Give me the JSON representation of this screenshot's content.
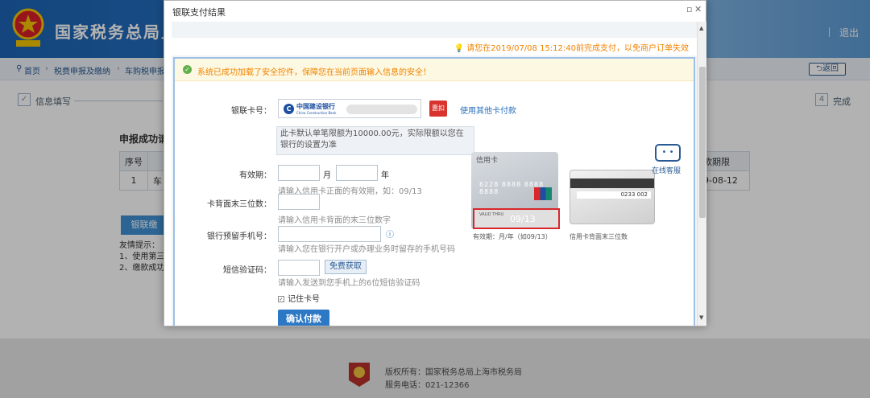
{
  "header": {
    "title": "国家税务总局上",
    "logout": "退出"
  },
  "breadcrumb": {
    "items": [
      "首页",
      "税费申报及缴纳",
      "车购税申报"
    ],
    "back": "返回"
  },
  "steps": {
    "first": "信息填写",
    "last_num": "4",
    "last": "完成"
  },
  "background": {
    "title": "申报成功请",
    "table_headers": [
      "序号",
      ""
    ],
    "table_row": [
      "1",
      "车"
    ],
    "right_header": "款期限",
    "right_value": "9-08-12",
    "button": "银联缴",
    "tips": [
      "友情提示：",
      "1、使用第三",
      "2、缴款成功"
    ]
  },
  "modal": {
    "title": "银联支付结果",
    "deadline_notice": "请您在2019/07/08 15:12:40前完成支付，以免商户订单失效",
    "security_notice": "系统已成功加载了安全控件，保障您在当前页面输入信息的安全！",
    "card_label": "银联卡号：",
    "bank_name": "中国建设银行",
    "bank_en": "China Construction Bank",
    "discount": "惠扣",
    "other_card": "使用其他卡付款",
    "limit_tip": "此卡默认单笔限额为10000.00元，实际限额以您在银行的设置为准",
    "expiry_label": "有效期：",
    "month": "月",
    "year": "年",
    "expiry_hint": "请输入信用卡正面的有效期，如：09/13",
    "cvv_label": "卡背面末三位数：",
    "cvv_hint": "请输入信用卡背面的末三位数字",
    "phone_label": "银行预留手机号：",
    "phone_hint": "请输入您在银行开户或办理业务时留存的手机号码",
    "sms_label": "短信验证码：",
    "sms_button": "免费获取",
    "sms_hint": "请输入发送到您手机上的6位短信验证码",
    "remember": "记住卡号",
    "confirm": "确认付款",
    "card_front_label": "信用卡",
    "card_number": "6228 8888 8888 8888",
    "valid_thru": "VALID THRU",
    "expiry_example": "09/13",
    "expiry_caption": "有效期：月/年（如09/13）",
    "cvv_example": "0233 002",
    "cvv_caption": "信用卡背面末三位数",
    "service": "在线客服"
  },
  "footer": {
    "copyright": "版权所有：国家税务总局上海市税务局",
    "phone": "服务电话：021-12366"
  }
}
